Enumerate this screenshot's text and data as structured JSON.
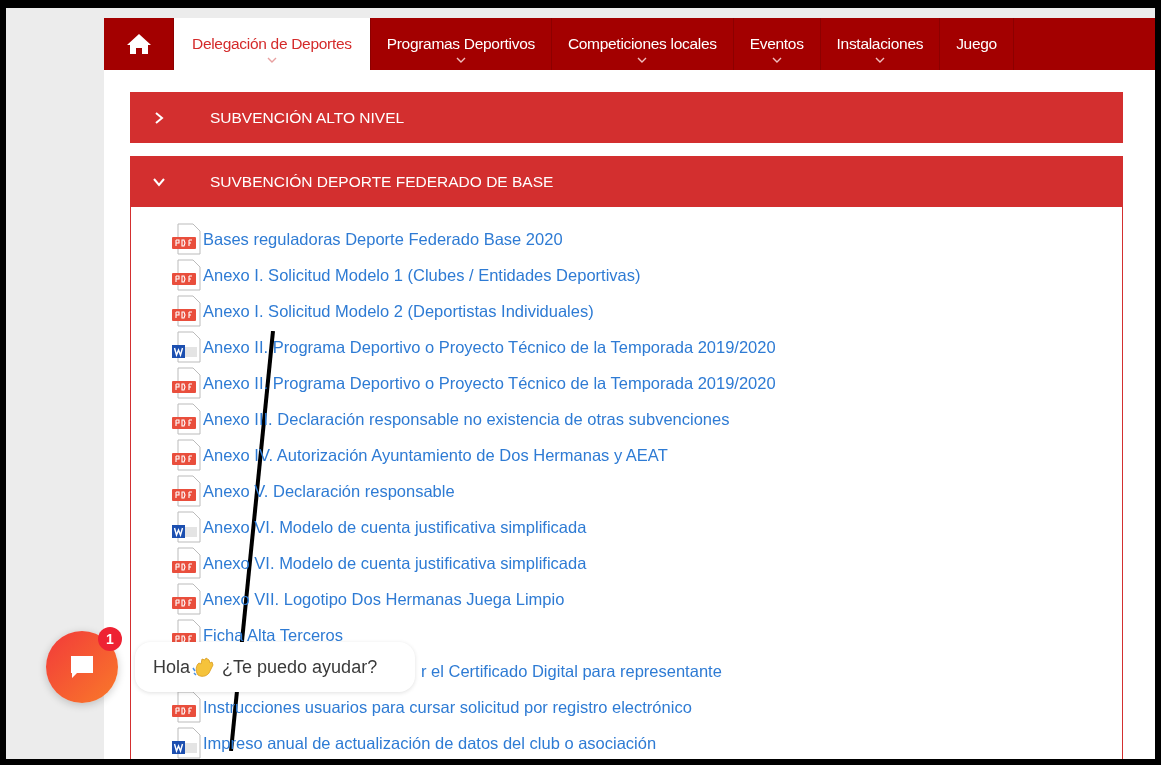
{
  "nav": {
    "items": [
      {
        "kind": "home",
        "selected": false,
        "dropdown": false
      },
      {
        "kind": "text",
        "label": "Delegación de Deportes",
        "selected": true,
        "dropdown": true
      },
      {
        "kind": "text",
        "label": "Programas Deportivos",
        "selected": false,
        "dropdown": true
      },
      {
        "kind": "text",
        "label": "Competiciones locales",
        "selected": false,
        "dropdown": true
      },
      {
        "kind": "text",
        "label": "Eventos",
        "selected": false,
        "dropdown": true
      },
      {
        "kind": "text",
        "label": "Instalaciones",
        "selected": false,
        "dropdown": true
      },
      {
        "kind": "text",
        "label": "Juego",
        "selected": false,
        "dropdown": false
      }
    ]
  },
  "accordions": [
    {
      "title": "SUBVENCIÓN ALTO NIVEL",
      "expanded": false
    },
    {
      "title": "SUVBENCIÓN DEPORTE FEDERADO DE BASE",
      "expanded": true,
      "documents": [
        {
          "kind": "pdf",
          "label": "Bases reguladoras Deporte Federado Base 2020"
        },
        {
          "kind": "pdf",
          "label": "Anexo I. Solicitud Modelo 1 (Clubes / Entidades Deportivas)"
        },
        {
          "kind": "pdf",
          "label": "Anexo I. Solicitud Modelo 2 (Deportistas Individuales)"
        },
        {
          "kind": "word",
          "label": "Anexo II. Programa Deportivo o Proyecto Técnico de la Temporada 2019/2020"
        },
        {
          "kind": "pdf",
          "label": "Anexo II. Programa Deportivo o Proyecto Técnico de la Temporada 2019/2020"
        },
        {
          "kind": "pdf",
          "label": "Anexo III. Declaración responsable no existencia de otras subvenciones"
        },
        {
          "kind": "pdf",
          "label": "Anexo IV. Autorización Ayuntamiento de Dos Hermanas y AEAT"
        },
        {
          "kind": "pdf",
          "label": "Anexo V. Declaración responsable"
        },
        {
          "kind": "word",
          "label": "Anexo VI. Modelo de cuenta justificativa simplificada"
        },
        {
          "kind": "pdf",
          "label": "Anexo VI. Modelo de cuenta justificativa simplificada"
        },
        {
          "kind": "pdf",
          "label": "Anexo VII. Logotipo Dos Hermanas Juega Limpio"
        },
        {
          "kind": "pdf",
          "label": "Ficha Alta Terceros"
        },
        {
          "kind": "covered",
          "label": "r el Certificado Digital para representante"
        },
        {
          "kind": "pdf",
          "label": "Instrucciones usuarios para cursar solicitud por registro electrónico"
        },
        {
          "kind": "word",
          "label": "Impreso anual de actualización de datos del club o asociación"
        }
      ]
    }
  ],
  "chat": {
    "badge": "1",
    "greeting": "Hola",
    "question": "¿Te puedo ayudar?"
  }
}
